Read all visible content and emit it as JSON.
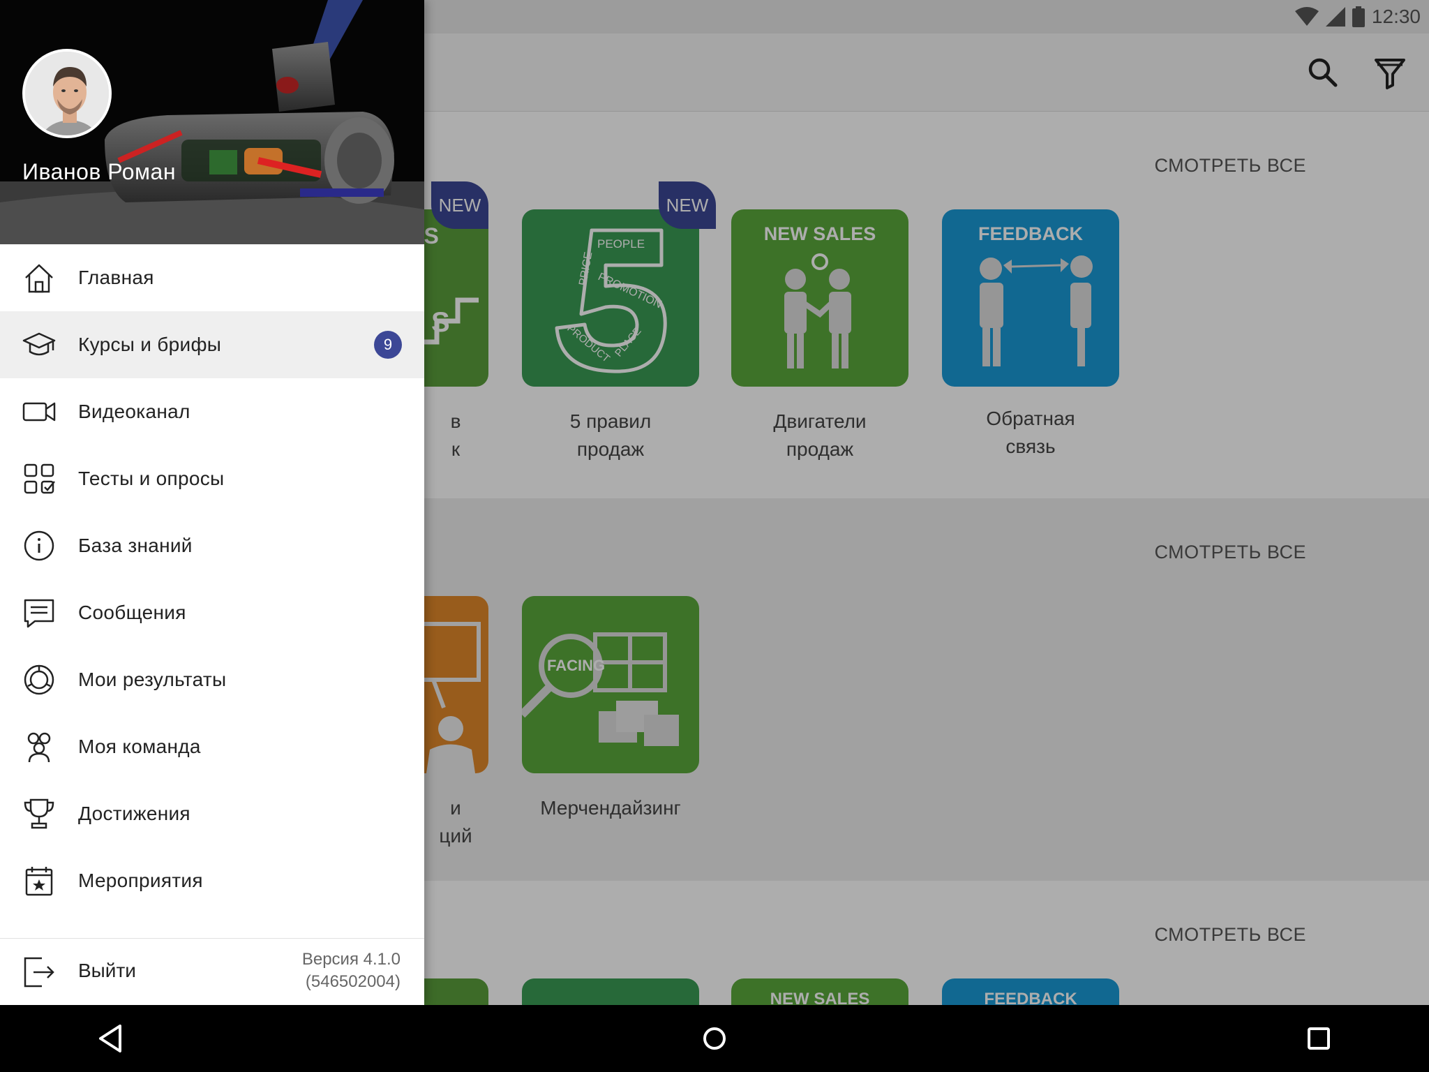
{
  "status": {
    "time": "12:30"
  },
  "header": {
    "user_name": "Иванов Роман"
  },
  "sections": [
    {
      "see_all": "СМОТРЕТЬ ВСЕ",
      "cards": [
        {
          "label_partial_1": "в",
          "label_partial_2": "к",
          "tile_title": "TEPS",
          "tile_sub": "S",
          "badge": "NEW",
          "color": "#5a9e3c"
        },
        {
          "label_1": "5 правил",
          "label_2": "продаж",
          "badge": "NEW",
          "color": "#3a9b55"
        },
        {
          "label_1": "Двигатели",
          "label_2": "продаж",
          "tile_title": "NEW SALES",
          "color": "#5aa83c"
        },
        {
          "label_1": "Обратная",
          "label_2": "связь",
          "tile_title": "FEEDBACK",
          "color": "#1a9ad6"
        }
      ]
    },
    {
      "see_all": "СМОТРЕТЬ ВСЕ",
      "cards": [
        {
          "label_partial_1": "и",
          "label_partial_2": "ций",
          "color": "#e0882a"
        },
        {
          "label_1": "Мерчендайзинг",
          "tile_title": "FACING",
          "color": "#5aa83c"
        }
      ]
    },
    {
      "see_all": "СМОТРЕТЬ ВСЕ",
      "cards": [
        {
          "tile_title": "NEW SALES",
          "color": "#5aa83c"
        },
        {
          "tile_title": "FEEDBACK",
          "color": "#1a9ad6"
        }
      ]
    }
  ],
  "tile_5": {
    "people": "PEOPLE",
    "price": "PRICE",
    "promotion": "PROMOTION",
    "product": "PRODUCT",
    "place": "PLACE"
  },
  "menu": [
    {
      "label": "Главная",
      "icon": "home-icon"
    },
    {
      "label": "Курсы и брифы",
      "icon": "graduation-cap-icon",
      "badge": "9"
    },
    {
      "label": "Видеоканал",
      "icon": "video-camera-icon"
    },
    {
      "label": "Тесты и опросы",
      "icon": "tests-grid-icon"
    },
    {
      "label": "База знаний",
      "icon": "info-icon"
    },
    {
      "label": "Сообщения",
      "icon": "message-icon"
    },
    {
      "label": "Мои результаты",
      "icon": "results-icon"
    },
    {
      "label": "Моя команда",
      "icon": "team-icon"
    },
    {
      "label": "Достижения",
      "icon": "trophy-icon"
    },
    {
      "label": "Мероприятия",
      "icon": "calendar-star-icon"
    }
  ],
  "footer": {
    "logout": "Выйти",
    "version_line1": "Версия 4.1.0",
    "version_line2": "(546502004)"
  },
  "colors": {
    "accent": "#3c4796",
    "green": "#5aa83c",
    "blue": "#1a9ad6",
    "orange": "#e0882a"
  }
}
